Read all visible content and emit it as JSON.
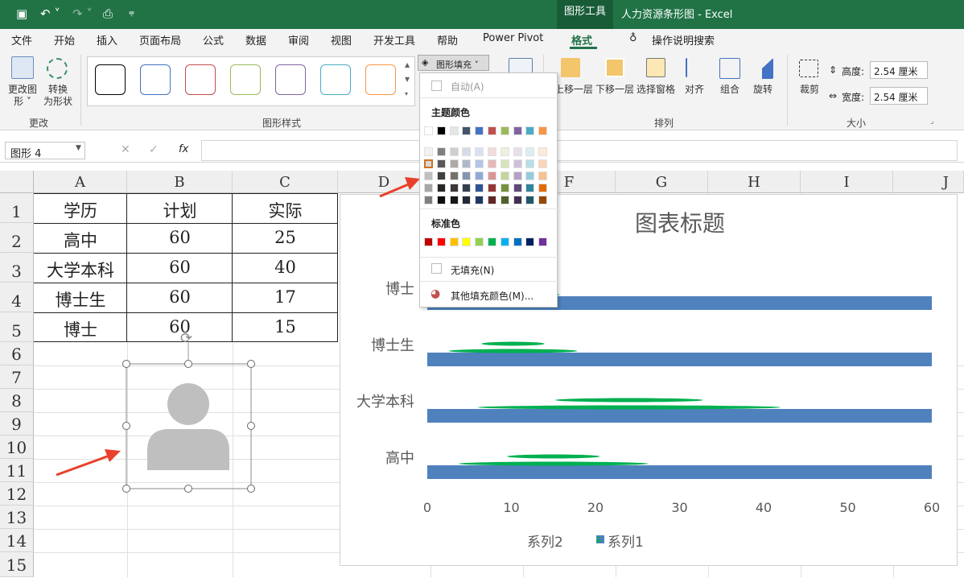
{
  "titlebar": {
    "tools_tab": "图形工具",
    "doc_title": "人力资源条形图  -  Excel"
  },
  "menu": [
    "文件",
    "开始",
    "插入",
    "页面布局",
    "公式",
    "数据",
    "审阅",
    "视图",
    "开发工具",
    "帮助",
    "Power Pivot",
    "格式",
    "操作说明搜索"
  ],
  "ribbon": {
    "change_shape": "更改图\n形 ˅",
    "convert_shape": "转换\n为形状",
    "group_change": "更改",
    "group_styles": "图形样式",
    "fill_button": "图形填充 ˅",
    "bring_forward": "上移一层",
    "send_backward": "下移一层",
    "selection_pane": "选择窗格",
    "align": "对齐",
    "group": "组合",
    "rotate": "旋转",
    "group_arrange": "排列",
    "crop": "裁剪",
    "height_label": "高度:",
    "height_value": "2.54 厘米",
    "width_label": "宽度:",
    "width_value": "2.54 厘米",
    "group_size": "大小",
    "style_colors": [
      "#000000",
      "#4472c4",
      "#c0504d",
      "#9bbb59",
      "#8064a2",
      "#4bacc6",
      "#f79646"
    ]
  },
  "formulabar": {
    "namebox": "图形 4",
    "fx": "fx",
    "cancel": "✕",
    "confirm": "✓"
  },
  "sheet": {
    "columns": [
      "A",
      "B",
      "C",
      "D",
      "E",
      "F",
      "G",
      "H",
      "I",
      "J"
    ],
    "rows": [
      "1",
      "2",
      "3",
      "4",
      "5",
      "6",
      "7",
      "8",
      "9",
      "10",
      "11",
      "12",
      "13",
      "14",
      "15"
    ],
    "table": [
      [
        "学历",
        "计划",
        "实际"
      ],
      [
        "高中",
        "60",
        "25"
      ],
      [
        "大学本科",
        "60",
        "40"
      ],
      [
        "博士生",
        "60",
        "17"
      ],
      [
        "博士",
        "60",
        "15"
      ]
    ]
  },
  "fill_menu": {
    "auto": "自动(A)",
    "theme_colors": "主题颜色",
    "standard_colors": "标准色",
    "no_fill": "无填充(N)",
    "more_colors": "其他填充颜色(M)...",
    "theme_row": [
      "#ffffff",
      "#000000",
      "#e7e6e6",
      "#44546a",
      "#4472c4",
      "#c0504d",
      "#9bbb59",
      "#8064a2",
      "#4bacc6",
      "#f79646"
    ],
    "shade_columns": [
      [
        "#f2f2f2",
        "#d9d9d9",
        "#bfbfbf",
        "#a6a6a6",
        "#7f7f7f"
      ],
      [
        "#7f7f7f",
        "#595959",
        "#404040",
        "#262626",
        "#0d0d0d"
      ],
      [
        "#d0cece",
        "#aeaaaa",
        "#757171",
        "#3a3838",
        "#171616"
      ],
      [
        "#d6dce4",
        "#adb9ca",
        "#8497b0",
        "#333f4f",
        "#222a35"
      ],
      [
        "#d9e2f3",
        "#b4c6e7",
        "#8eaadb",
        "#2f5496",
        "#1f3864"
      ],
      [
        "#f2dcdb",
        "#e6b9b8",
        "#da9694",
        "#953735",
        "#632523"
      ],
      [
        "#ebf1dd",
        "#d7e3bc",
        "#c3d69b",
        "#76923c",
        "#4f6128"
      ],
      [
        "#e5e0ec",
        "#ccc1d9",
        "#b2a2c7",
        "#5f497a",
        "#3f3151"
      ],
      [
        "#dbeef3",
        "#b7dde8",
        "#92cddc",
        "#31859b",
        "#205867"
      ],
      [
        "#fdeada",
        "#fbd5b5",
        "#fac08f",
        "#e36c09",
        "#974806"
      ]
    ],
    "standard_row": [
      "#c00000",
      "#ff0000",
      "#ffc000",
      "#ffff00",
      "#92d050",
      "#00b050",
      "#00b0f0",
      "#0070c0",
      "#002060",
      "#7030a0"
    ]
  },
  "chart_data": {
    "type": "bar",
    "title": "图表标题",
    "categories": [
      "高中",
      "大学本科",
      "博士生",
      "博士"
    ],
    "series": [
      {
        "name": "系列1",
        "values": [
          60,
          60,
          60,
          60
        ],
        "color": "#4f81bd"
      },
      {
        "name": "系列2",
        "values": [
          25,
          40,
          17,
          15
        ],
        "color": "#00b050"
      }
    ],
    "xlim": [
      0,
      60
    ],
    "ticks": [
      "0",
      "10",
      "20",
      "30",
      "40",
      "50",
      "60"
    ],
    "legend": "bottom"
  }
}
